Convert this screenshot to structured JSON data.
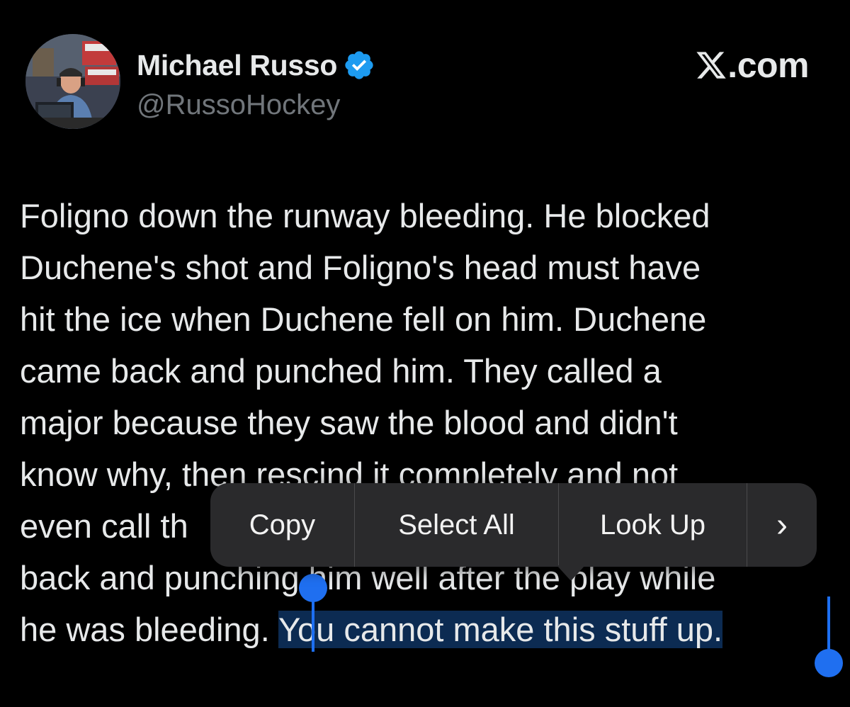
{
  "author": {
    "display_name": "Michael Russo",
    "handle": "@RussoHockey",
    "avatar_icon": "profile-photo",
    "verified_icon": "verified-badge-icon",
    "verified_color": "#1d9bf0"
  },
  "brand": {
    "logo_icon": "x-logo-icon",
    "text": ".com"
  },
  "tweet": {
    "lines": [
      "Foligno down the runway bleeding. He blocked",
      "Duchene's shot and Foligno's head must have",
      "hit the ice when Duchene fell on him. Duchene",
      "came back and punched him. They called a",
      "major because they saw the blood and didn't",
      "know why, then rescind it completely and not",
      "even call th",
      "back and punching him well after the play while",
      "he was bleeding. "
    ],
    "selected_text": "You cannot make this stuff up."
  },
  "context_menu": {
    "items": [
      "Copy",
      "Select All",
      "Look Up"
    ],
    "more_icon": "chevron-right-icon",
    "more_label": "›"
  },
  "colors": {
    "background": "#000000",
    "text": "#e7e9ea",
    "secondary_text": "#71767b",
    "selection_bg": "#0c2b52",
    "selection_handle": "#1f6ff0",
    "menu_bg": "#2a2a2c"
  }
}
